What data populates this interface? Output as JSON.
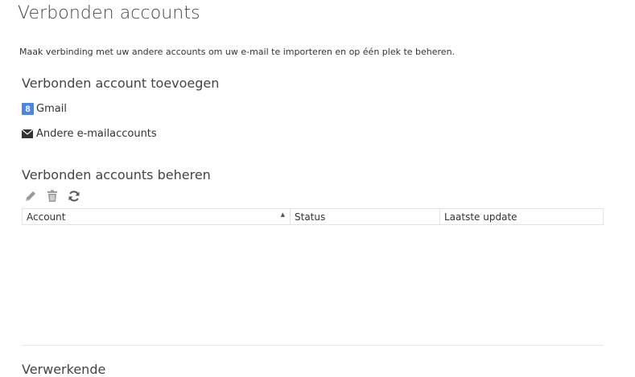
{
  "page": {
    "title": "Verbonden accounts",
    "description": "Maak verbinding met uw andere accounts om uw e-mail te importeren en op één plek te beheren."
  },
  "add_section": {
    "heading": "Verbonden account toevoegen",
    "gmail_label": "Gmail",
    "gmail_badge": "8",
    "other_label": "Andere e-mailaccounts"
  },
  "manage_section": {
    "heading": "Verbonden accounts beheren",
    "toolbar": {
      "icons": [
        "pencil-icon",
        "trash-icon",
        "refresh-icon"
      ]
    },
    "table": {
      "columns": [
        "Account",
        "Status",
        "Laatste update"
      ],
      "sorted_column": "Account",
      "sort_direction": "ascending",
      "rows": []
    }
  },
  "next_section": {
    "heading_partial": "Verwerkende"
  },
  "colors": {
    "gmail_badge": "#4a86e8",
    "icon_gray": "#8a8a8a",
    "border": "#e3e3e3"
  }
}
